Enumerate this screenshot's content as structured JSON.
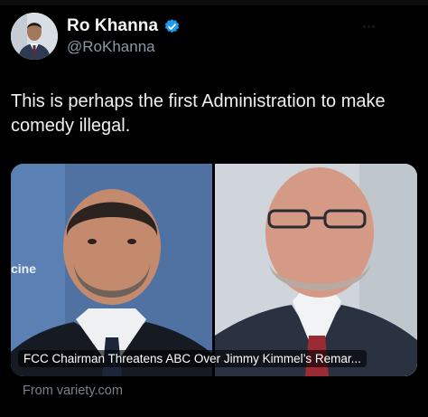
{
  "author": {
    "display_name": "Ro Khanna",
    "handle": "@RoKhanna",
    "verified": true,
    "verified_color": "#1d9bf0"
  },
  "tweet": {
    "text": "This is perhaps the first Administration to make comedy illegal."
  },
  "link_card": {
    "left_photo_text": "cine",
    "title": "FCC Chairman Threatens ABC Over Jimmy Kimmel’s Remar...",
    "source": "From variety.com"
  },
  "icons": {
    "verified": "verified-badge-icon",
    "more": "more-options-icon"
  },
  "colors": {
    "background": "#000000",
    "text_primary": "#e7e9ea",
    "text_secondary": "#8b98a5"
  }
}
